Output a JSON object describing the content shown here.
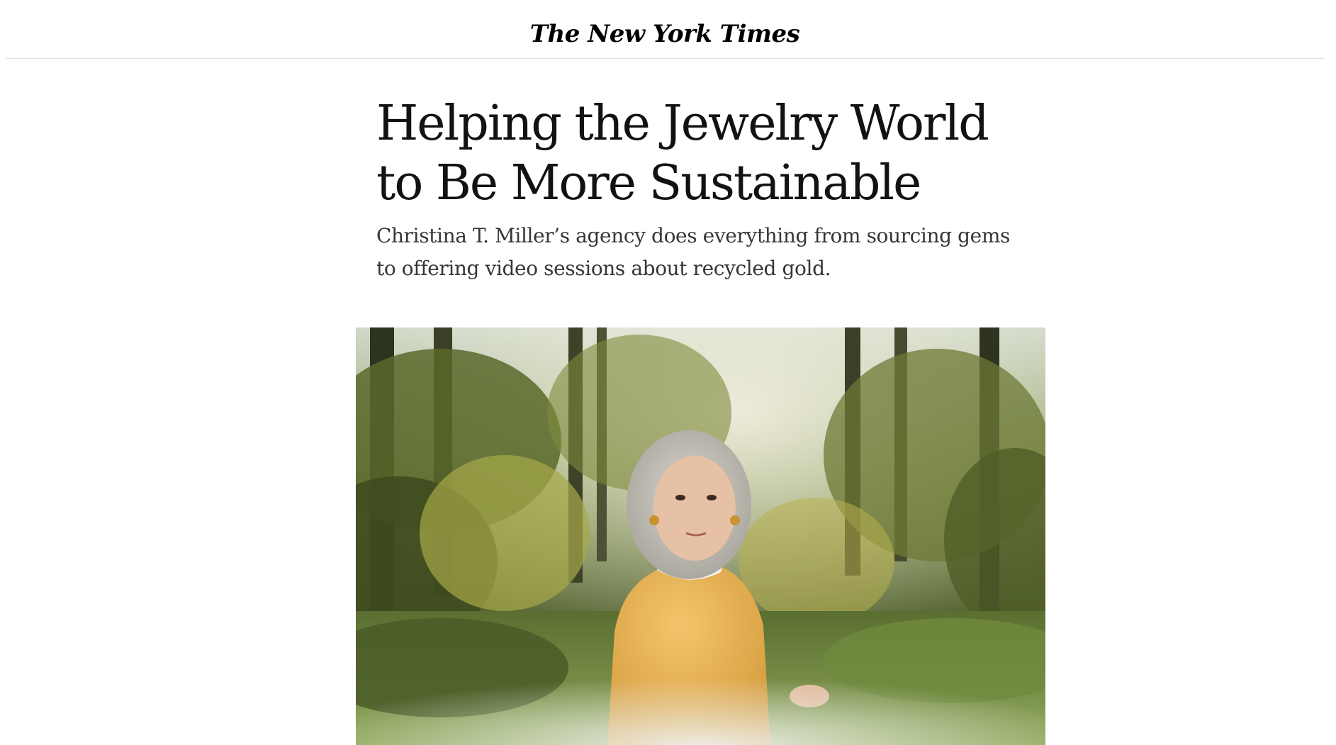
{
  "masthead": {
    "logo_text": "The New York Times"
  },
  "article": {
    "headline": "Helping the Jewelry World to Be More Sustainable",
    "summary": "Christina T. Miller’s agency does everything from sourcing gems to offering video sessions about recycled gold."
  },
  "colors": {
    "text": "#121212",
    "summary_text": "#363636",
    "rule": "#dfdfdf",
    "background": "#ffffff"
  }
}
